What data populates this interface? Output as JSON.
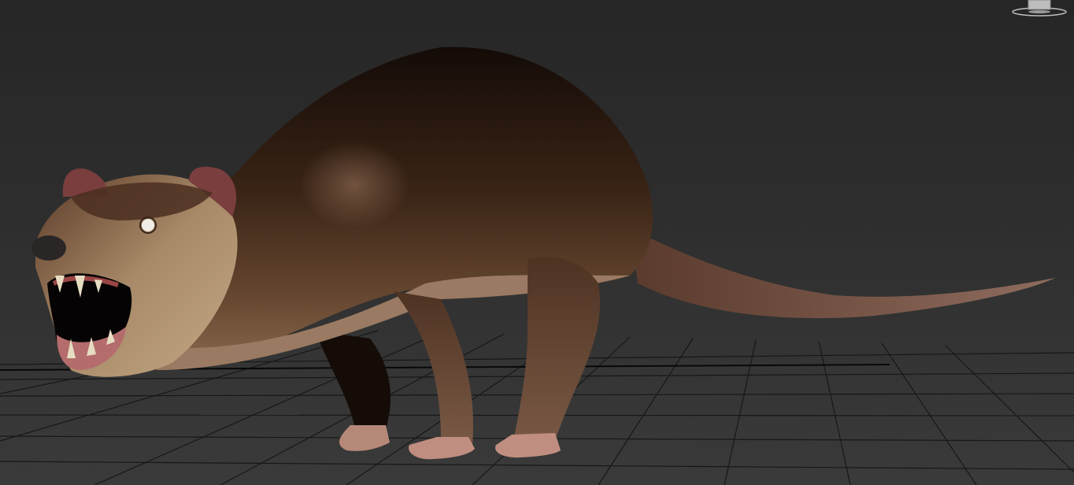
{
  "viewport": {
    "view_mode": "perspective",
    "shading": "realistic",
    "background_color": "#2e2e2e",
    "grid_color": "#111111",
    "model": {
      "subject": "rat-creature",
      "fur_dark": "#1e120c",
      "fur_mid": "#4a2e1e",
      "fur_light": "#8a6a4c",
      "skin_pink": "#b8857a",
      "mouth_red": "#9a4545",
      "teeth_color": "#e6dcc2"
    }
  },
  "viewcube": {
    "icon": "viewcube-icon",
    "base_color": "#bdbdbd"
  }
}
